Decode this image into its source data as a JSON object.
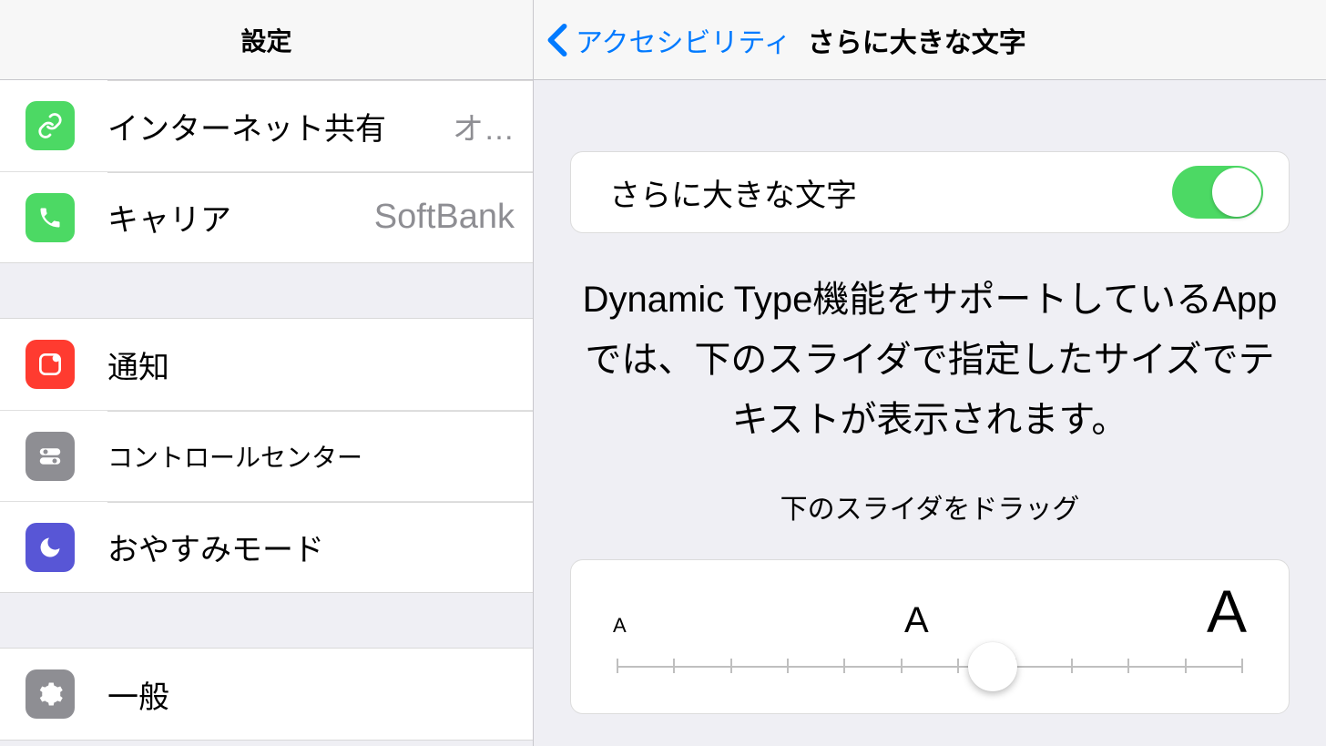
{
  "sidebar": {
    "title": "設定",
    "group1": [
      {
        "label": "インターネット共有",
        "value": "オ…"
      },
      {
        "label": "キャリア",
        "value": "SoftBank"
      }
    ],
    "group2": [
      {
        "label": "通知"
      },
      {
        "label": "コントロールセンター"
      },
      {
        "label": "おやすみモード"
      }
    ],
    "group3": [
      {
        "label": "一般"
      }
    ]
  },
  "detail": {
    "back_label": "アクセシビリティ",
    "title": "さらに大きな文字",
    "toggle_label": "さらに大きな文字",
    "toggle_on": true,
    "description": "Dynamic Type機能をサポートしているAppでは、下のスライダで指定したサイズでテキストが表示されます。",
    "drag_hint": "下のスライダをドラッグ",
    "slider": {
      "small": "A",
      "mid": "A",
      "large": "A",
      "ticks": 12,
      "position_percent": 56
    }
  }
}
